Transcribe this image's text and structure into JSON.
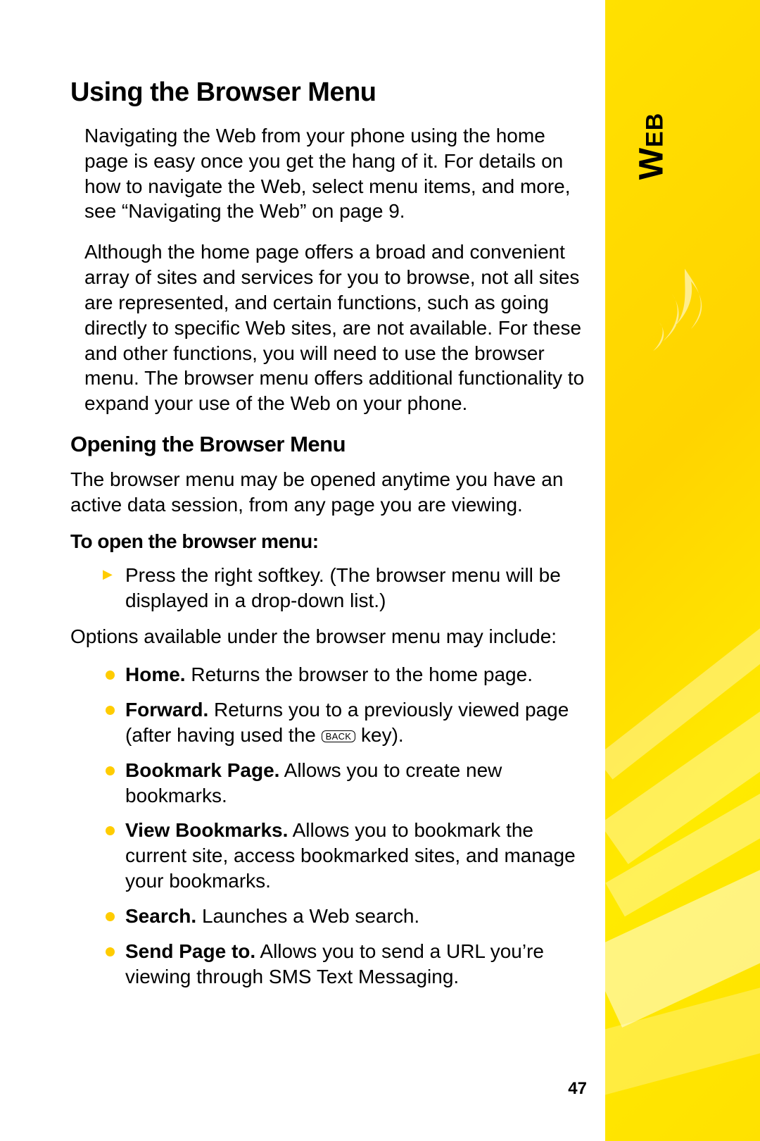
{
  "tab_label": "Web",
  "page_number": "47",
  "h1": "Using the Browser Menu",
  "para1": "Navigating the Web from your phone using the home page is easy once you get the hang of it. For details on how to navigate the Web, select menu items, and more, see “Navigating the Web” on page 9.",
  "para2": "Although the home page offers a broad and convenient array of sites and services for you to browse, not all sites are represented, and certain functions, such as going directly to specific Web sites, are not available. For these and other functions, you will need to use the browser menu. The browser menu offers additional functionality to expand your use of the Web on your phone.",
  "h2": "Opening the Browser Menu",
  "para3": "The browser menu may be opened anytime you have an active data session, from any page you are viewing.",
  "lead": "To open the browser menu:",
  "arrow_item": "Press the right softkey. (The browser menu will be displayed in a drop-down list.)",
  "para4": "Options available under the browser menu may include:",
  "options": [
    {
      "term": "Home.",
      "desc": " Returns the browser to the home page."
    },
    {
      "term": "Forward.",
      "desc_a": " Returns you to a previously viewed page (after having used the ",
      "key": "BACK",
      "desc_b": " key)."
    },
    {
      "term": "Bookmark Page.",
      "desc": " Allows you to create new bookmarks."
    },
    {
      "term": "View Bookmarks.",
      "desc": " Allows you to bookmark the current site, access bookmarked sites, and manage your bookmarks."
    },
    {
      "term": "Search.",
      "desc": " Launches a Web search."
    },
    {
      "term": "Send Page to.",
      "desc": " Allows you to send a URL you’re viewing through SMS Text Messaging."
    }
  ]
}
